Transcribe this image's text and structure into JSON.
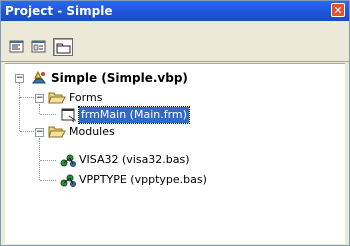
{
  "window": {
    "title": "Project - Simple",
    "close_glyph": "✕"
  },
  "toolbar": {
    "buttons": [
      {
        "name": "view-code",
        "icon": "view-code-icon"
      },
      {
        "name": "view-object",
        "icon": "view-object-icon"
      },
      {
        "name": "toggle-folders",
        "icon": "folder-icon",
        "pressed": true
      }
    ]
  },
  "tree": {
    "project": {
      "label": "Simple (Simple.vbp)",
      "expander": "−"
    },
    "forms": {
      "label": "Forms",
      "expander": "−"
    },
    "form_main": {
      "label": "frmMain (Main.frm)"
    },
    "modules": {
      "label": "Modules",
      "expander": "−"
    },
    "module_visa": {
      "label": "VISA32 (visa32.bas)"
    },
    "module_vpp": {
      "label": "VPPTYPE (vpptype.bas)"
    }
  },
  "colors": {
    "titlebar": "#1d55d8",
    "selection": "#316ac5",
    "chrome": "#ece9d8"
  }
}
